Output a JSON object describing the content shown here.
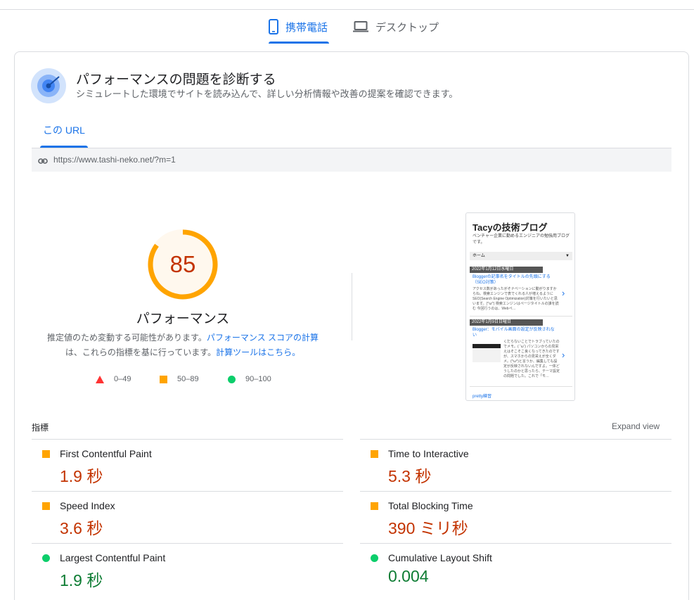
{
  "device_tabs": {
    "mobile_label": "携帯電話",
    "desktop_label": "デスクトップ"
  },
  "diagnose": {
    "title": "パフォーマンスの問題を診断する",
    "subtitle": "シミュレートした環境でサイトを読み込んで、詳しい分析情報や改善の提案を確認できます。"
  },
  "url_tab": {
    "label": "この URL",
    "url": "https://www.tashi-neko.net/?m=1"
  },
  "score": {
    "value": "85",
    "fraction": 0.85,
    "label": "パフォーマンス",
    "desc_1": "推定値のため変動する可能性があります。",
    "desc_link_1": "パフォーマンス スコアの計算",
    "desc_2": "は、これらの指標を基に行っています。",
    "desc_link_2": "計算ツールはこちら。"
  },
  "legend": [
    {
      "range": "0–49",
      "icon": "triangle-red"
    },
    {
      "range": "50–89",
      "icon": "square-orange"
    },
    {
      "range": "90–100",
      "icon": "circle-green"
    }
  ],
  "thumbnail": {
    "blog_title": "Tacyの技術ブログ",
    "blog_desc": "ベンチャー企業に勤めるエンジニアの勉強用ブログです。",
    "menu": "ホーム",
    "menu_arrow": "▼",
    "date_1": "2022年1月12日水曜日",
    "post_1_title": "Bloggerの記事名をタイトルの先頭にする（SEO対策）",
    "post_1_excerpt": "アクセス数があったがそナベーションに動がりますからね。検索エンジンで表でくれる人が増えるようにSEO(Search Engine Optimization)対策を行いたいと思います。(^ω^) 検索エンジンはページタイトルの誰を読む 今回行うのは、Webペ…",
    "date_2": "2022年1月9日日曜日",
    "post_2_title": "Blogger：モバイル画面の設定が反映されない",
    "post_2_excerpt": "くだらないことでトラブっていたのでメモ。( ˘ω˘) パソコンからの見栄えはそこそこ良くなってきたのですが、スマホからの見栄えが全くダメ。(^ω^)と言うか、編集しても設定が反映されないんですよ。一体どうしたのかと思ったら、テーマ設定の問題でした。これで「モ…",
    "chevron": "›",
    "footer": "pretty練習"
  },
  "metrics": {
    "heading": "指標",
    "expand": "Expand view",
    "items": [
      {
        "name": "First Contentful Paint",
        "value": "1.9 秒",
        "rating": "average"
      },
      {
        "name": "Time to Interactive",
        "value": "5.3 秒",
        "rating": "average"
      },
      {
        "name": "Speed Index",
        "value": "3.6 秒",
        "rating": "average"
      },
      {
        "name": "Total Blocking Time",
        "value": "390 ミリ秒",
        "rating": "average"
      },
      {
        "name": "Largest Contentful Paint",
        "value": "1.9 秒",
        "rating": "good"
      },
      {
        "name": "Cumulative Layout Shift",
        "value": "0.004",
        "rating": "good"
      }
    ]
  },
  "colors": {
    "accent": "#1a73e8",
    "average": "#ffa400",
    "average_text": "#c33300",
    "good": "#0cce6b",
    "good_text": "#0d7c33",
    "fail": "#ff3333"
  }
}
